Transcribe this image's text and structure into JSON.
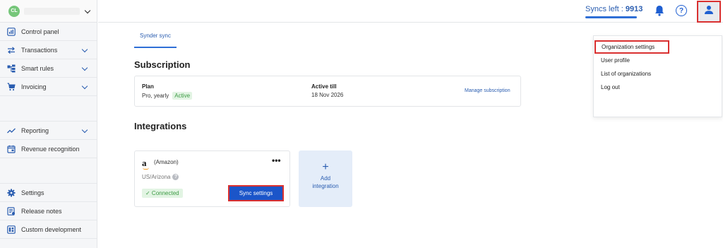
{
  "org": {
    "avatar_initials": "CL"
  },
  "sidebar": {
    "items": [
      {
        "label": "Control panel"
      },
      {
        "label": "Transactions"
      },
      {
        "label": "Smart rules"
      },
      {
        "label": "Invoicing"
      },
      {
        "label": "Reporting"
      },
      {
        "label": "Revenue recognition"
      },
      {
        "label": "Settings"
      },
      {
        "label": "Release notes"
      },
      {
        "label": "Custom development"
      }
    ]
  },
  "topbar": {
    "syncs_label": "Syncs left :",
    "syncs_value": "9913",
    "help_glyph": "?"
  },
  "main": {
    "tab_label": "Synder sync",
    "subscription": {
      "heading": "Subscription",
      "plan_label": "Plan",
      "plan_value": "Pro, yearly",
      "plan_status": "Active",
      "active_till_label": "Active till",
      "active_till_value": "18 Nov 2026",
      "manage_label": "Manage subscription"
    },
    "integrations": {
      "heading": "Integrations",
      "card": {
        "logo_letter": "a",
        "name": "(Amazon)",
        "more_label": "•••",
        "region": "US/Arizona",
        "region_help": "?",
        "status": "✓ Connected",
        "sync_button": "Sync settings"
      },
      "add": {
        "plus": "+",
        "line1": "Add",
        "line2": "integration"
      }
    }
  },
  "user_menu": {
    "items": [
      {
        "label": "Organization settings"
      },
      {
        "label": "User profile"
      },
      {
        "label": "List of organizations"
      },
      {
        "label": "Log out"
      }
    ]
  },
  "colors": {
    "accent": "#2f6fd6",
    "primary_button": "#1b55c9",
    "highlight_border": "#d93030",
    "success": "#3d9b45"
  }
}
